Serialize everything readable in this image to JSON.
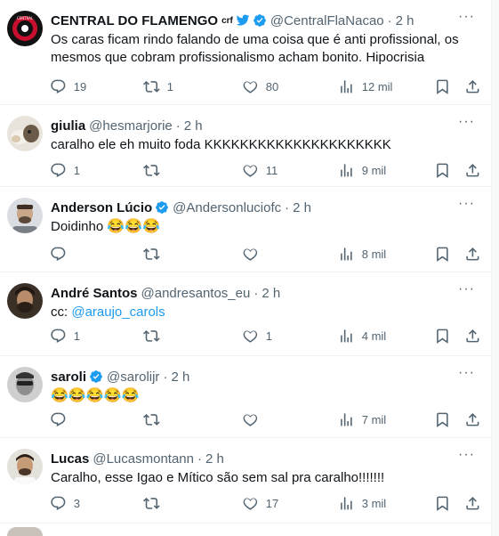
{
  "tweets": [
    {
      "name": "CENTRAL DO FLAMENGO",
      "flair": "crf",
      "verified": true,
      "handle": "@CentralFlaNacao",
      "time": "2 h",
      "text": "Os caras ficam rindo falando de uma coisa que é anti profissional, os mesmos que cobram profissionalismo acham bonito. Hipocrisia",
      "replies": "19",
      "retweets": "1",
      "likes": "80",
      "views": "12 mil"
    },
    {
      "name": "giulia",
      "verified": false,
      "handle": "@hesmarjorie",
      "time": "2 h",
      "text": "caralho ele eh muito foda KKKKKKKKKKKKKKKKKKKKK",
      "replies": "1",
      "retweets": "",
      "likes": "11",
      "views": "9 mil"
    },
    {
      "name": "Anderson Lúcio",
      "verified": true,
      "handle": "@Andersonluciofc",
      "time": "2 h",
      "text": "Doidinho",
      "text_emoji": "😂😂😂",
      "replies": "",
      "retweets": "",
      "likes": "",
      "views": "8 mil"
    },
    {
      "name": "André Santos",
      "verified": false,
      "handle": "@andresantos_eu",
      "time": "2 h",
      "text": "cc: ",
      "mention": "@araujo_carols",
      "replies": "1",
      "retweets": "",
      "likes": "1",
      "views": "4 mil"
    },
    {
      "name": "saroli",
      "verified": true,
      "handle": "@sarolijr",
      "time": "2 h",
      "text_emoji": "😂😂😂😂😂",
      "replies": "",
      "retweets": "",
      "likes": "",
      "views": "7 mil"
    },
    {
      "name": "Lucas",
      "verified": false,
      "handle": "@Lucasmontann",
      "time": "2 h",
      "text": "Caralho, esse Igao e Mítico são sem sal pra caralho!!!!!!!",
      "replies": "3",
      "retweets": "",
      "likes": "17",
      "views": "3 mil"
    }
  ],
  "separator": "·",
  "more_glyph": "···",
  "colors": {
    "text": "#0f1419",
    "secondary": "#536471",
    "verified": "#1d9bf0",
    "mention": "#1d9bf0",
    "divider": "#eff3f4"
  }
}
